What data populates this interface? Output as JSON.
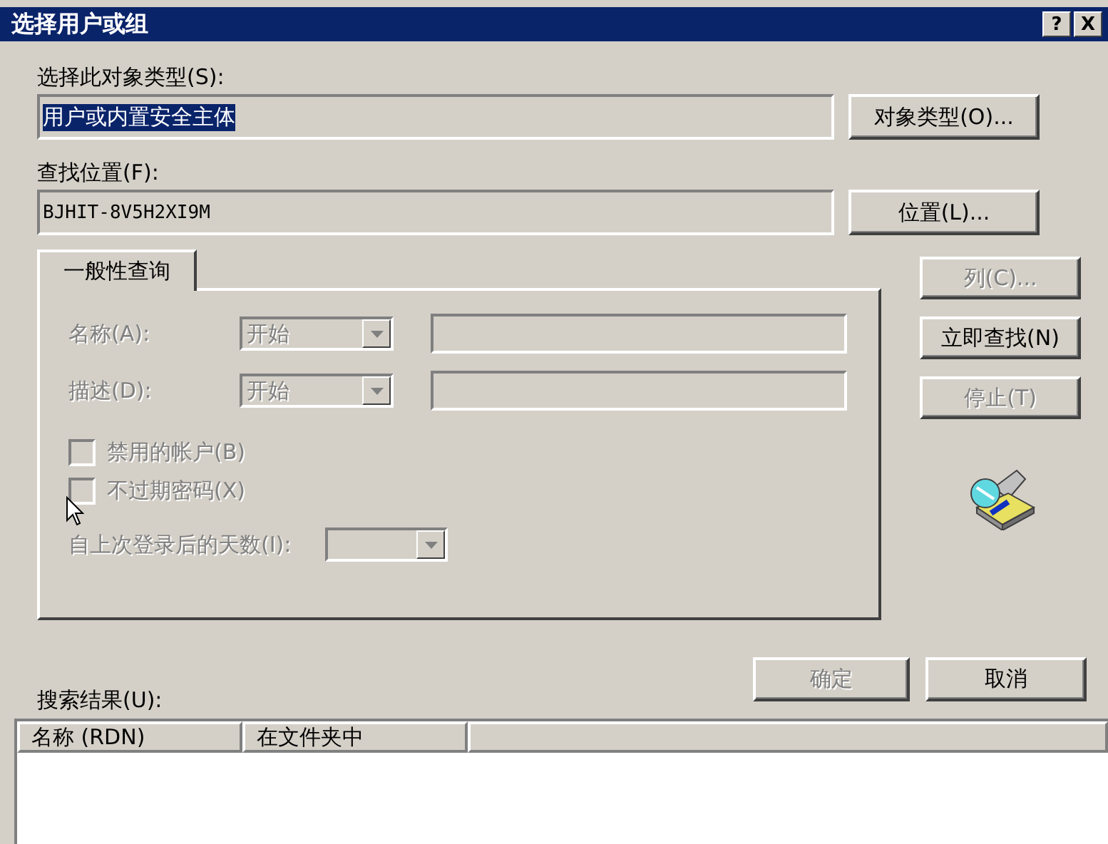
{
  "window": {
    "title": "选择用户或组",
    "title_buttons": [
      "?",
      "X"
    ]
  },
  "object_type": {
    "label": "选择此对象类型(S):",
    "value": "用户或内置安全主体",
    "selected": true,
    "button": {
      "label": "对象类型(O)...",
      "disabled": false
    }
  },
  "location": {
    "label": "查找位置(F):",
    "value": "BJHIT-8V5H2XI9M",
    "selected": false,
    "button": {
      "label": "位置(L)...",
      "disabled": false
    }
  },
  "tabs": [
    {
      "label": "一般性查询",
      "selected": true
    }
  ],
  "query": {
    "rows": [
      {
        "label": "名称(A):",
        "mode": "开始",
        "disabled": true
      },
      {
        "label": "描述(D):",
        "mode": "开始",
        "disabled": true
      }
    ],
    "checkboxes": [
      {
        "label": "禁用的帐户(B)",
        "checked": false,
        "disabled": true
      },
      {
        "label": "不过期密码(X)",
        "checked": false,
        "disabled": true
      }
    ],
    "days": {
      "label": "自上次登录后的天数(I):",
      "disabled": true
    }
  },
  "side_buttons": [
    {
      "label": "列(C)...",
      "disabled": true
    },
    {
      "label": "立即查找(N)",
      "disabled": false
    },
    {
      "label": "停止(T)",
      "disabled": true
    }
  ],
  "dialog_buttons": [
    {
      "label": "确定",
      "disabled": true
    },
    {
      "label": "取消",
      "disabled": false
    }
  ],
  "results": {
    "label": "搜索结果(U):",
    "columns": [
      "名称 (RDN)",
      "在文件夹中"
    ]
  }
}
